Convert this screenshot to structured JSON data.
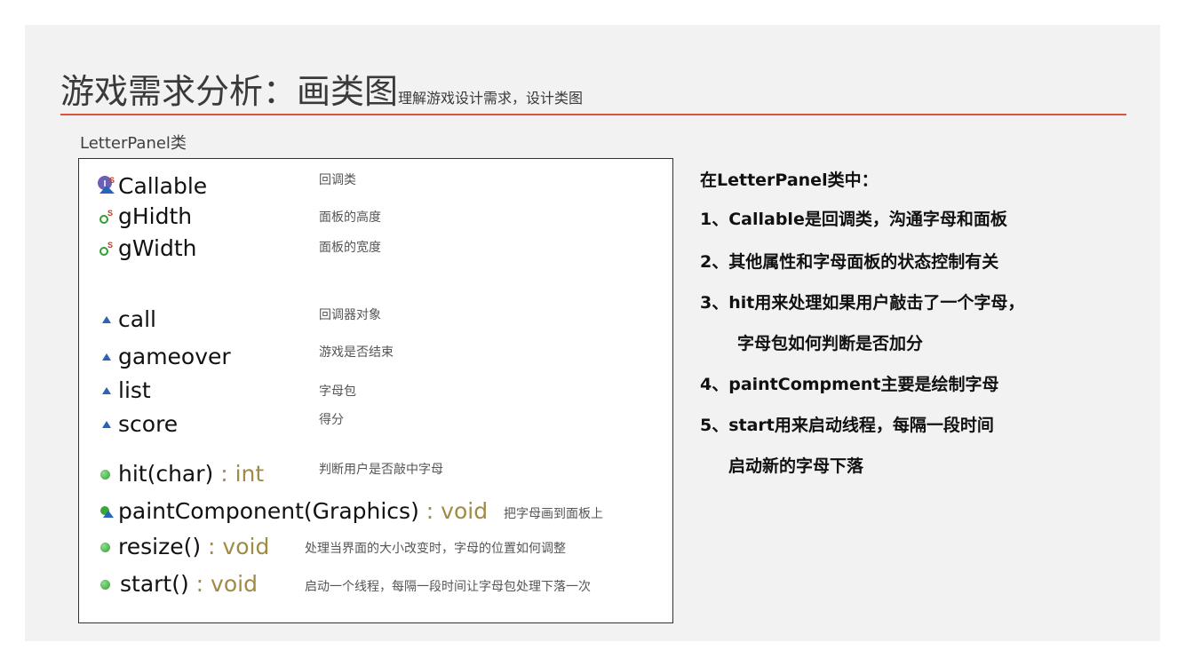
{
  "title": {
    "main": "游戏需求分析：画类图",
    "sub": "理解游戏设计需求，设计类图"
  },
  "class_label": "LetterPanel类",
  "members": {
    "callable": {
      "name": "Callable",
      "desc": "回调类"
    },
    "gHidth": {
      "name": "gHidth",
      "desc": "面板的高度"
    },
    "gWidth": {
      "name": "gWidth",
      "desc": "面板的宽度"
    },
    "call": {
      "name": "call",
      "desc": "回调器对象"
    },
    "gameover": {
      "name": "gameover",
      "desc": "游戏是否结束"
    },
    "list": {
      "name": "list",
      "desc": "字母包"
    },
    "score": {
      "name": "score",
      "desc": "得分"
    },
    "hit": {
      "name": "hit(char)",
      "type": " : int",
      "desc": "判断用户是否敲中字母"
    },
    "paint": {
      "name": "paintComponent(Graphics)",
      "type": " : void",
      "desc": "把字母画到面板上"
    },
    "resize": {
      "name": "resize()",
      "type": " : void",
      "desc": "处理当界面的大小改变时，字母的位置如何调整"
    },
    "start": {
      "name": "start()",
      "type": " : void",
      "desc": "启动一个线程，每隔一段时间让字母包处理下落一次"
    }
  },
  "notes": {
    "heading": "在LetterPanel类中：",
    "items": [
      "1、Callable是回调类，沟通字母和面板",
      "2、其他属性和字母面板的状态控制有关",
      "3、hit用来处理如果用户敲击了一个字母，",
      "字母包如何判断是否加分",
      "4、paintCompment主要是绘制字母",
      "5、start用来启动线程，每隔一段时间",
      "启动新的字母下落"
    ]
  },
  "colors": {
    "accent_rule": "#d9553c",
    "type_text": "#a08a44",
    "method_dot": "#2fa02f",
    "field_triangle": "#2a64b8"
  },
  "icons": {
    "callable": "interface-static-icon",
    "static_field": "static-field-icon",
    "package_field": "package-field-triangle-icon",
    "public_method": "public-method-dot-icon",
    "protected_method": "protected-method-icon"
  }
}
